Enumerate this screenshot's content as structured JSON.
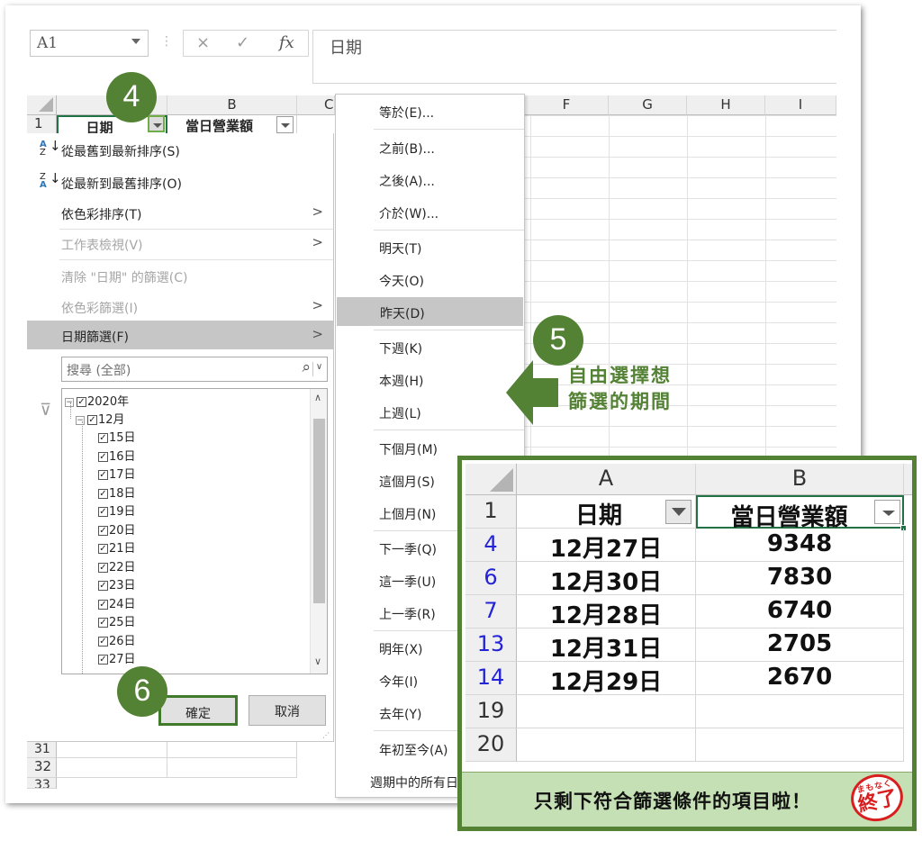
{
  "excel": {
    "name_box": "A1",
    "formula_cancel": "×",
    "formula_enter": "✓",
    "formula_fx": "fx",
    "formula_value": "日期",
    "columns": [
      "B",
      "C",
      "F",
      "G",
      "H",
      "I"
    ],
    "header_row": {
      "row": "1",
      "a": "日期",
      "b": "當日營業額"
    },
    "lower_rows": [
      "31",
      "32",
      "33"
    ]
  },
  "filter_panel": {
    "sort_asc": "從最舊到最新排序(S)",
    "sort_desc": "從最新到最舊排序(O)",
    "sort_by_color": "依色彩排序(T)",
    "sheet_view": "工作表檢視(V)",
    "clear_filter": "清除 \"日期\" 的篩選(C)",
    "filter_by_color": "依色彩篩選(I)",
    "date_filters": "日期篩選(F)",
    "search_placeholder": "搜尋 (全部)",
    "tree_year": "2020年",
    "tree_month": "12月",
    "tree_days": [
      "15日",
      "16日",
      "17日",
      "18日",
      "19日",
      "20日",
      "21日",
      "22日",
      "23日",
      "24日",
      "25日",
      "26日",
      "27日"
    ],
    "ok": "確定",
    "cancel": "取消"
  },
  "date_submenu": {
    "items": [
      "等於(E)...",
      "之前(B)...",
      "之後(A)...",
      "介於(W)...",
      "明天(T)",
      "今天(O)",
      "昨天(D)",
      "下週(K)",
      "本週(H)",
      "上週(L)",
      "下個月(M)",
      "這個月(S)",
      "上個月(N)",
      "下一季(Q)",
      "這一季(U)",
      "上一季(R)",
      "明年(X)",
      "今年(I)",
      "去年(Y)",
      "年初至今(A)",
      "週期中的所有日"
    ],
    "highlighted": "昨天(D)"
  },
  "steps": {
    "s4": "4",
    "s5": "5",
    "s6": "6"
  },
  "callout": {
    "line1": "自由選擇想",
    "line2": "篩選的期間"
  },
  "result": {
    "col_a": "A",
    "col_b": "B",
    "header_row": "1",
    "header_a": "日期",
    "header_b": "當日營業額",
    "rows": [
      {
        "row": "4",
        "date": "12月27日",
        "sales": "9348"
      },
      {
        "row": "6",
        "date": "12月30日",
        "sales": "7830"
      },
      {
        "row": "7",
        "date": "12月28日",
        "sales": "6740"
      },
      {
        "row": "13",
        "date": "12月31日",
        "sales": "2705"
      },
      {
        "row": "14",
        "date": "12月29日",
        "sales": "2670"
      }
    ],
    "empty_rows": [
      "19",
      "20"
    ],
    "footer": "只剩下符合篩選條件的項目啦！",
    "seal_top": "まもなく",
    "seal_main": "終了"
  }
}
